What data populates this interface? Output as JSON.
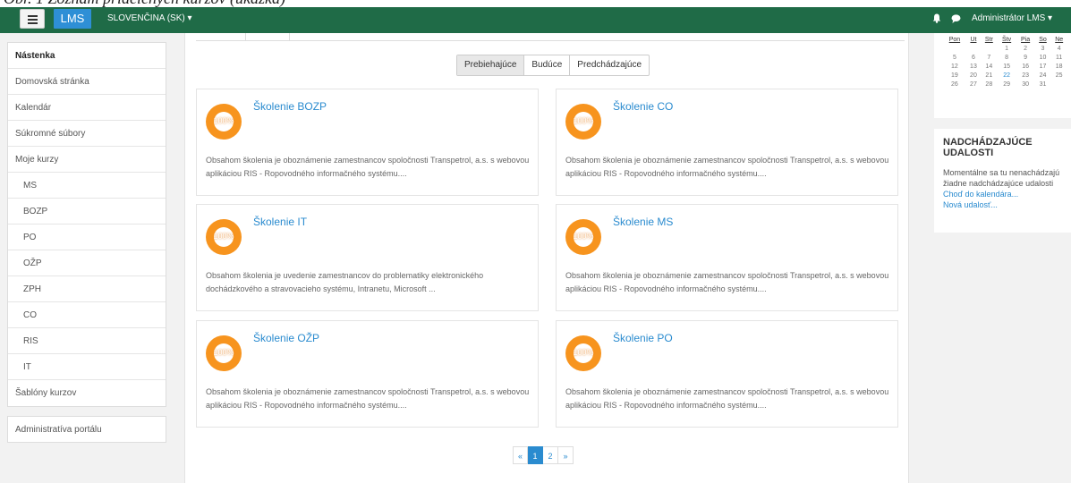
{
  "caption": "Obr. 1 Zoznam pridelených kurzov (ukážka)",
  "navbar": {
    "brand": "LMS",
    "language": "SLOVENČINA (SK) ▾",
    "user": "Administrátor LMS ▾"
  },
  "sidebar": {
    "items": [
      {
        "label": "Nástenka",
        "active": true
      },
      {
        "label": "Domovská stránka"
      },
      {
        "label": "Kalendár"
      },
      {
        "label": "Súkromné súbory"
      },
      {
        "label": "Moje kurzy"
      },
      {
        "label": "MS",
        "child": true
      },
      {
        "label": "BOZP",
        "child": true
      },
      {
        "label": "PO",
        "child": true
      },
      {
        "label": "OŽP",
        "child": true
      },
      {
        "label": "ZPH",
        "child": true
      },
      {
        "label": "CO",
        "child": true
      },
      {
        "label": "RIS",
        "child": true
      },
      {
        "label": "IT",
        "child": true
      },
      {
        "label": "Šablóny kurzov"
      }
    ],
    "admin": "Administratíva portálu"
  },
  "filter": {
    "options": [
      "Prebiehajúce",
      "Budúce",
      "Predchádzajúce"
    ],
    "selected": "Prebiehajúce"
  },
  "courses": [
    {
      "title": "Školenie BOZP",
      "progress": "100%",
      "desc": "Obsahom školenia je oboznámenie zamestnancov spoločnosti Transpetrol, a.s. s webovou aplikáciou RIS - Ropovodného informačného systému...."
    },
    {
      "title": "Školenie CO",
      "progress": "100%",
      "desc": "Obsahom školenia je oboznámenie zamestnancov spoločnosti Transpetrol, a.s. s webovou aplikáciou RIS - Ropovodného informačného systému...."
    },
    {
      "title": "Školenie IT",
      "progress": "100%",
      "desc": "Obsahom školenia je uvedenie zamestnancov do problematiky elektronického dochádzkového a stravovacieho systému, Intranetu, Microsoft ..."
    },
    {
      "title": "Školenie MS",
      "progress": "100%",
      "desc": "Obsahom školenia je oboznámenie zamestnancov spoločnosti Transpetrol, a.s. s webovou aplikáciou RIS - Ropovodného informačného systému...."
    },
    {
      "title": "Školenie OŽP",
      "progress": "100%",
      "desc": "Obsahom školenia je oboznámenie zamestnancov spoločnosti Transpetrol, a.s. s webovou aplikáciou RIS - Ropovodného informačného systému...."
    },
    {
      "title": "Školenie PO",
      "progress": "100%",
      "desc": "Obsahom školenia je oboznámenie zamestnancov spoločnosti Transpetrol, a.s. s webovou aplikáciou RIS - Ropovodného informačného systému...."
    }
  ],
  "pagination": {
    "prev": "«",
    "pages": [
      "1",
      "2"
    ],
    "current": "1",
    "next": "»"
  },
  "calendar": {
    "weekdays": [
      "Pon",
      "Ut",
      "Str",
      "Štv",
      "Pia",
      "So",
      "Ne"
    ],
    "weeks": [
      [
        "",
        "",
        "",
        "",
        "1",
        "2",
        "3",
        "4"
      ],
      [
        "5",
        "6",
        "7",
        "8",
        "9",
        "10",
        "11"
      ],
      [
        "12",
        "13",
        "14",
        "15",
        "16",
        "17",
        "18"
      ],
      [
        "19",
        "20",
        "21",
        "22",
        "23",
        "24",
        "25"
      ],
      [
        "26",
        "27",
        "28",
        "29",
        "30",
        "31",
        ""
      ]
    ],
    "today": "22"
  },
  "events": {
    "title": "Nadchádzajúce udalosti",
    "text": "Momentálne sa tu nenachádzajú žiadne nadchádzajúce udalosti",
    "link_calendar": "Choď do kalendára...",
    "link_new": "Nová udalosť..."
  },
  "colors": {
    "navbar": "#1f6b47",
    "brand": "#2e8fd6",
    "accent": "#2a8bcf",
    "progress": "#f7941e"
  }
}
